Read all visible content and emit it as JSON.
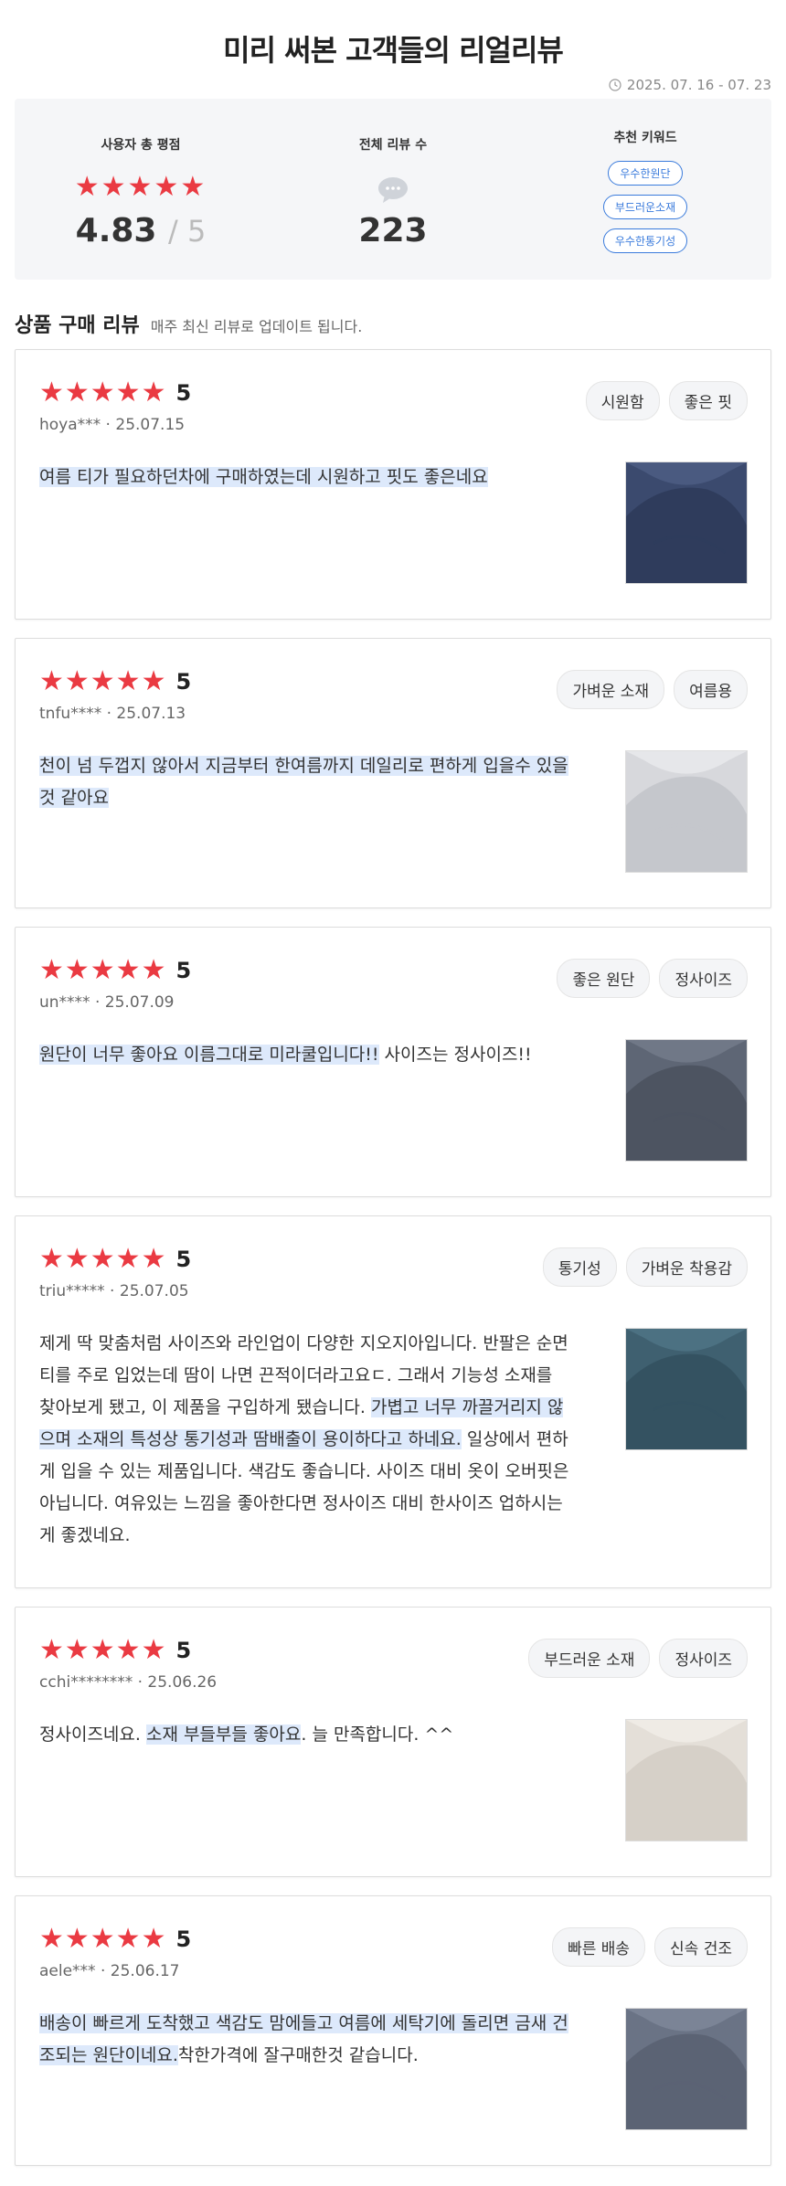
{
  "header": {
    "title": "미리 써본 고객들의 리얼리뷰",
    "period": "2025. 07. 16 - 07. 23"
  },
  "summary": {
    "rating_label": "사용자 총 평점",
    "stars": "★★★★★",
    "rating_value": "4.83",
    "rating_max": "/ 5",
    "count_label": "전체 리뷰 수",
    "count_value": "223",
    "keyword_label": "추천 키워드",
    "keywords": [
      "우수한원단",
      "부드러운소재",
      "우수한통기성"
    ]
  },
  "section": {
    "title": "상품 구매 리뷰",
    "subtitle": "매주 최신 리뷰로 업데이트 됩니다."
  },
  "colors": {
    "star": "#ea3a42",
    "keyword": "#3a7bdc",
    "highlight": "#dde9fb"
  },
  "reviews": [
    {
      "stars": "★★★★★",
      "score": "5",
      "user": "hoya***",
      "date": "25.07.15",
      "tags": [
        "시원함",
        "좋은 핏"
      ],
      "parts": [
        {
          "text": "여름 티가 필요하던차에 구매하였는데 시원하고 핏도 좋은네요",
          "hl": true
        }
      ],
      "image": "navy-tshirt-photo"
    },
    {
      "stars": "★★★★★",
      "score": "5",
      "user": "tnfu****",
      "date": "25.07.13",
      "tags": [
        "가벼운 소재",
        "여름용"
      ],
      "parts": [
        {
          "text": "천이 넘 두껍지 않아서 지금부터 한여름까지 데일리로 편하게 입을수 있을것 같아요",
          "hl": true
        }
      ],
      "image": "white-tshirt-photo"
    },
    {
      "stars": "★★★★★",
      "score": "5",
      "user": "un****",
      "date": "25.07.09",
      "tags": [
        "좋은 원단",
        "정사이즈"
      ],
      "parts": [
        {
          "text": "원단이 너무 좋아요 이름그대로 미라쿨입니다!!",
          "hl": true
        },
        {
          "text": " 사이즈는 정사이즈!!",
          "hl": false
        }
      ],
      "image": "grey-tshirt-photo"
    },
    {
      "stars": "★★★★★",
      "score": "5",
      "user": "triu*****",
      "date": "25.07.05",
      "tags": [
        "통기성",
        "가벼운 착용감"
      ],
      "parts": [
        {
          "text": "제게 딱 맞춤처럼 사이즈와 라인업이 다양한 지오지아입니다. 반팔은 순면티를 주로 입었는데 땀이 나면 끈적이더라고요ㄷ. 그래서 기능성 소재를 찾아보게 됐고, 이 제품을 구입하게 됐습니다. ",
          "hl": false
        },
        {
          "text": "가볍고 너무 까끌거리지 않으며 소재의 특성상 통기성과 땀배출이 용이하다고 하네요.",
          "hl": true
        },
        {
          "text": " 일상에서 편하게 입을 수 있는 제품입니다. 색감도 좋습니다. 사이즈 대비 옷이 오버핏은 아닙니다. 여유있는 느낌을 좋아한다면 정사이즈 대비 한사이즈 업하시는 게 좋겠네요.",
          "hl": false
        }
      ],
      "image": "teal-tshirt-photo"
    },
    {
      "stars": "★★★★★",
      "score": "5",
      "user": "cchi********",
      "date": "25.06.26",
      "tags": [
        "부드러운 소재",
        "정사이즈"
      ],
      "parts": [
        {
          "text": "정사이즈네요. ",
          "hl": false
        },
        {
          "text": "소재 부들부들 좋아요",
          "hl": true
        },
        {
          "text": ". 늘 만족합니다. ^^",
          "hl": false
        }
      ],
      "image": "beige-tshirt-photo"
    },
    {
      "stars": "★★★★★",
      "score": "5",
      "user": "aele***",
      "date": "25.06.17",
      "tags": [
        "빠른 배송",
        "신속 건조"
      ],
      "parts": [
        {
          "text": "배송이 빠르게 도착했고 색감도 맘에들고 여름에 세탁기에 돌리면 금새 건조되는 원단이네요.",
          "hl": true
        },
        {
          "text": "착한가격에 잘구매한것 같습니다.",
          "hl": false
        }
      ],
      "image": "bluegrey-tshirt-photo"
    }
  ]
}
